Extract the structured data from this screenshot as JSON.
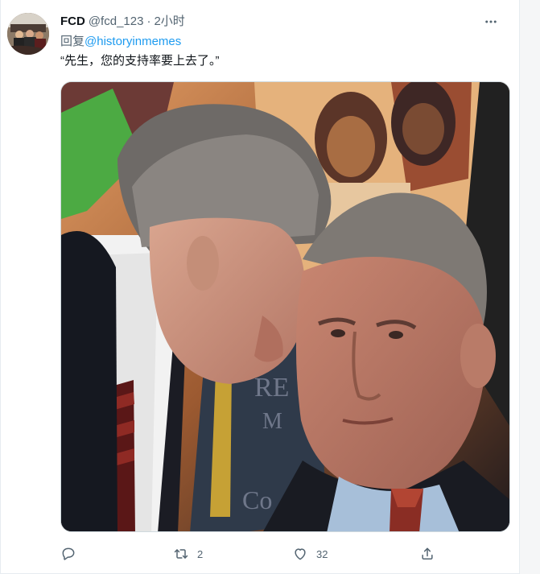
{
  "tweet": {
    "display_name": "FCD",
    "handle": "@fcd_123",
    "separator": "·",
    "time": "2小时",
    "reply_prefix": "回复",
    "reply_to": "@historyinmemes",
    "text": "“先生，您的支持率要上去了。”",
    "stats": {
      "replies": "",
      "retweets": "2",
      "likes": "32"
    }
  },
  "icons": {
    "more": "more-horizontal-icon",
    "reply": "reply-bubble-icon",
    "retweet": "retweet-icon",
    "like": "heart-icon",
    "share": "share-upload-icon"
  },
  "colors": {
    "link": "#1d9bf0",
    "secondary_text": "#536471",
    "primary_text": "#0f1419",
    "border": "#cfd9de"
  }
}
